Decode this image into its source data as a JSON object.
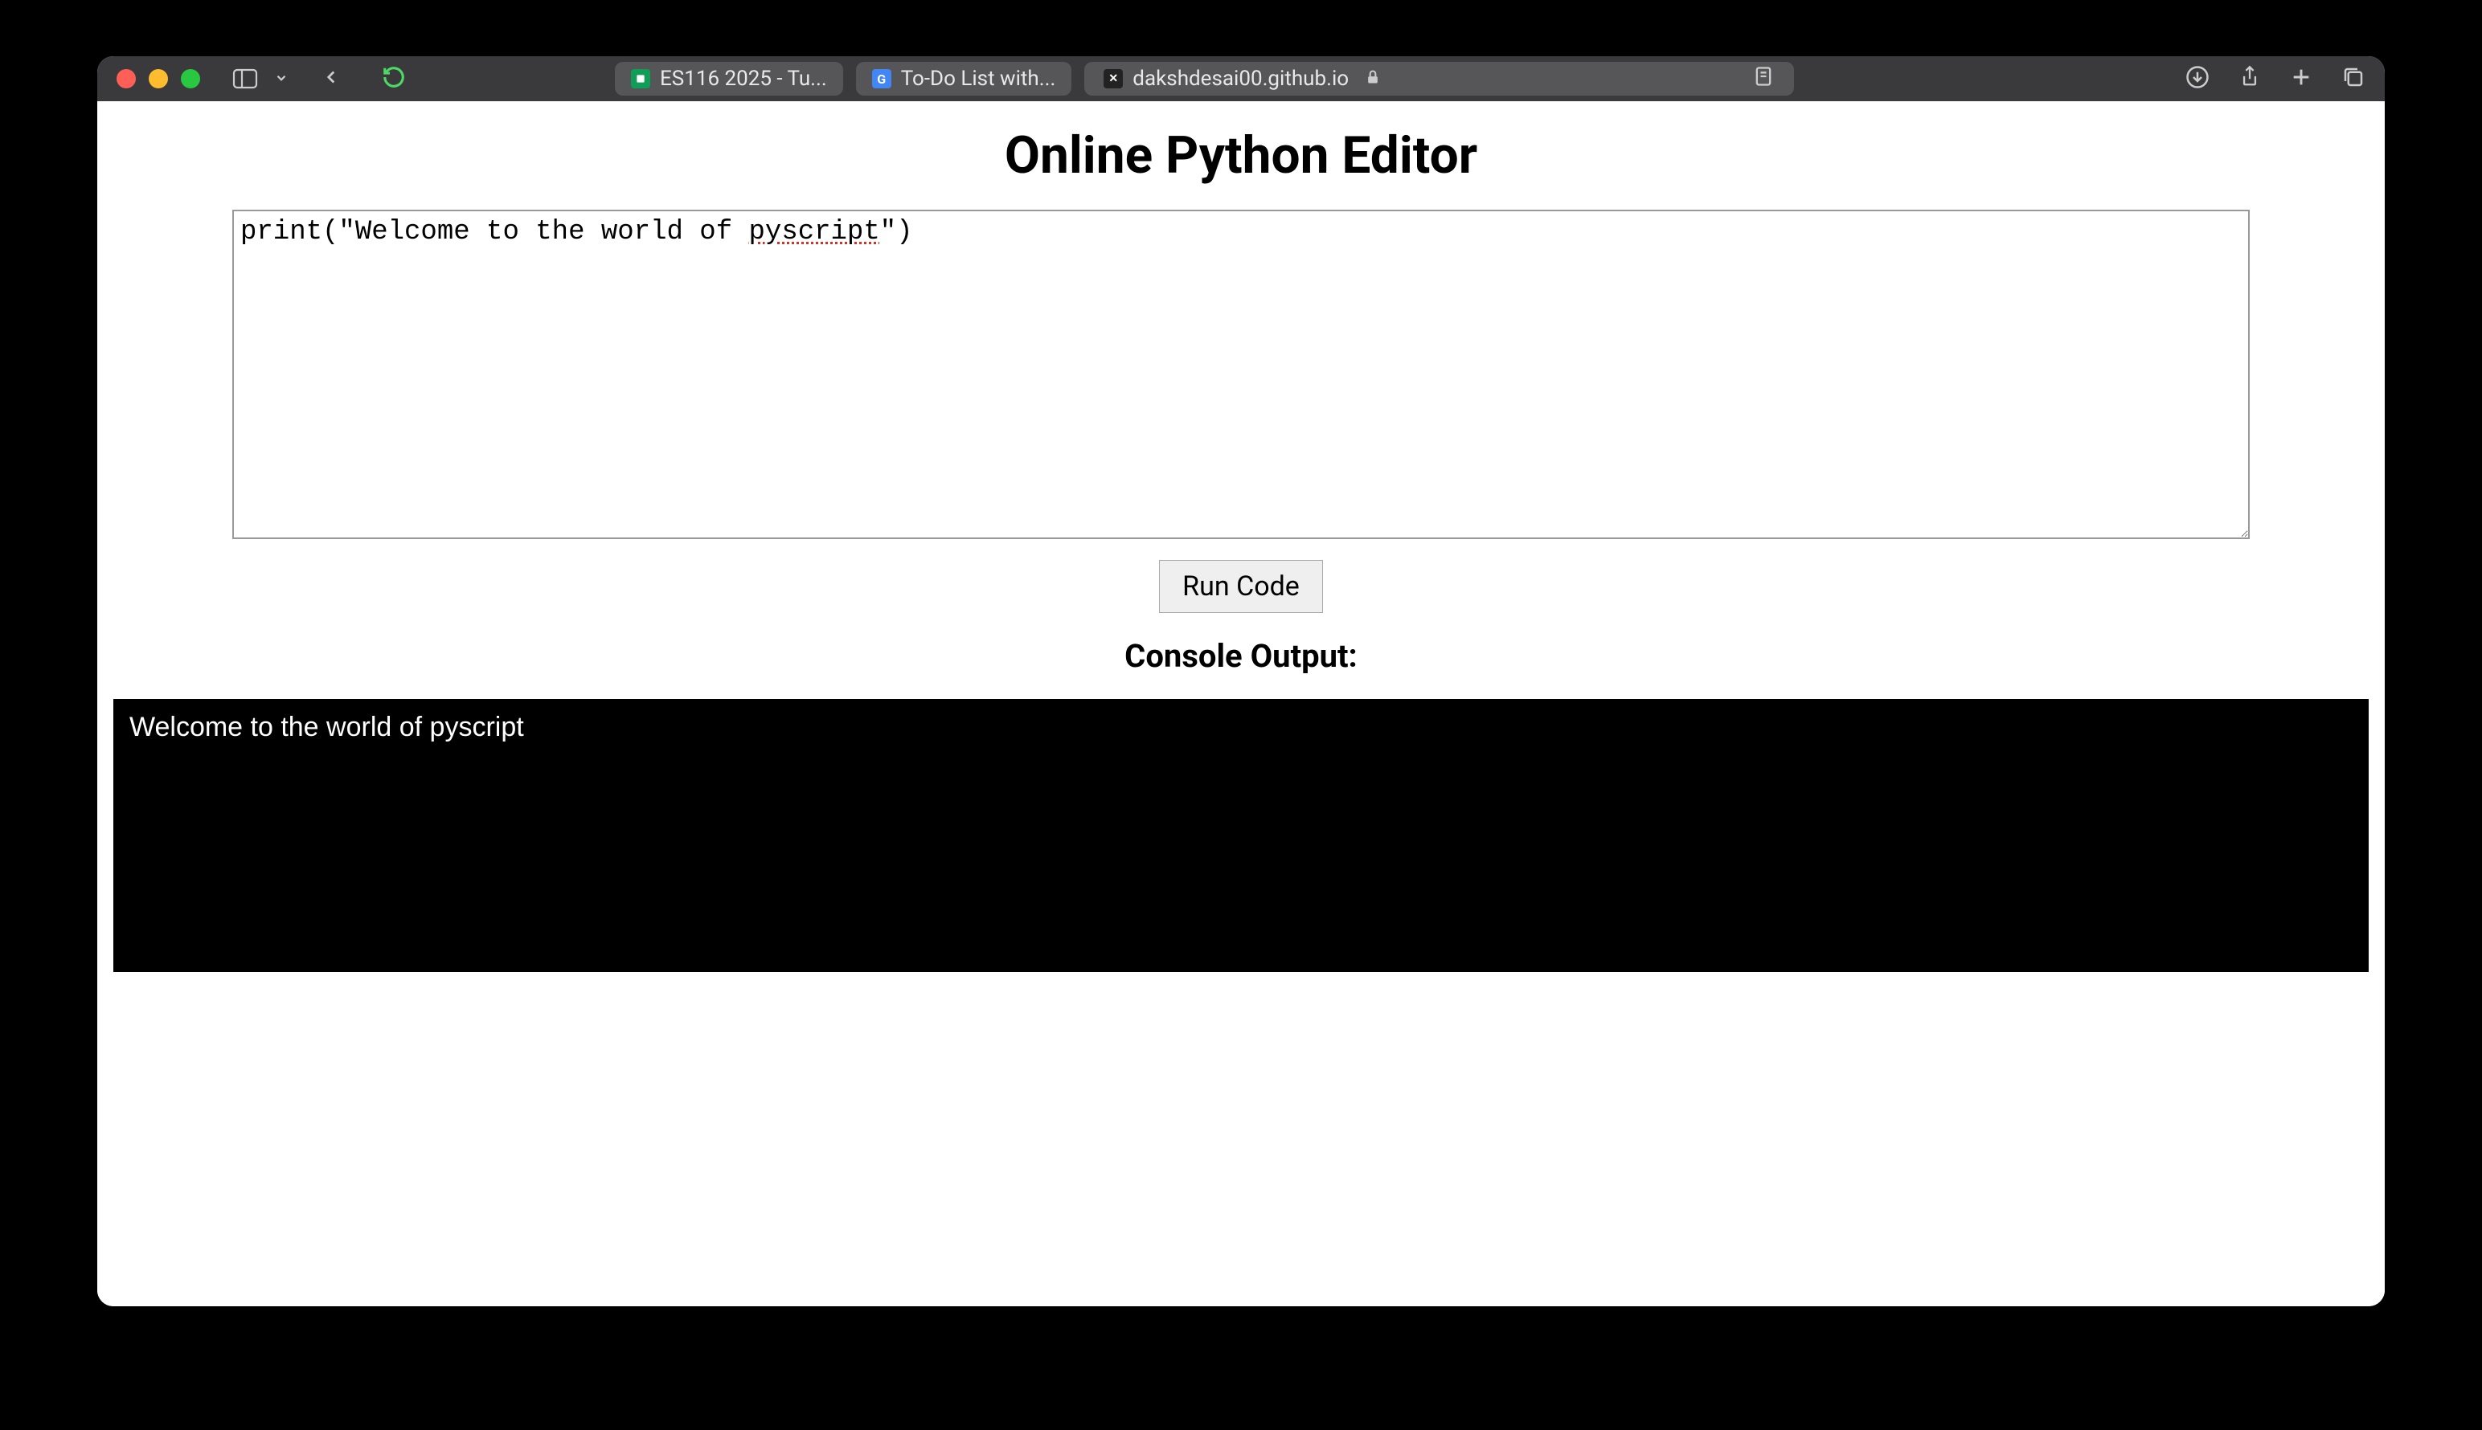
{
  "browser": {
    "tabs": [
      {
        "label": "ES116 2025 - Tu...",
        "favicon": "green"
      },
      {
        "label": "To-Do List with...",
        "favicon": "blue",
        "favicon_letter": "G"
      }
    ],
    "address": "dakshdesai00.github.io"
  },
  "page": {
    "title": "Online Python Editor",
    "code_prefix": "print(\"Welcome to the world of ",
    "code_spellword": "pyscript",
    "code_suffix": "\")",
    "run_label": "Run Code",
    "console_heading": "Console Output:",
    "console_text": "Welcome to the world of pyscript"
  }
}
